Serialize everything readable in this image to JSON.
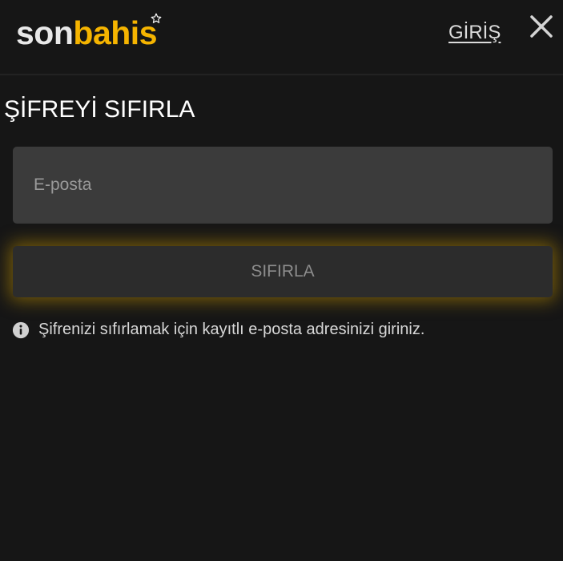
{
  "header": {
    "logo_part1": "son",
    "logo_part2": "bahis",
    "login_label": "GİRİŞ"
  },
  "main": {
    "title": "ŞİFREYİ SIFIRLA",
    "email_placeholder": "E-posta",
    "email_value": "",
    "reset_label": "SIFIRLA",
    "hint": "Şifrenizi sıfırlamak için kayıtlı e-posta adresinizi giriniz."
  },
  "icons": {
    "close": "close-icon",
    "info": "info-icon",
    "star": "star-icon"
  },
  "colors": {
    "background": "#161616",
    "brand_yellow": "#f5b400",
    "input_bg": "#3b3b3b",
    "button_bg": "#2c2c2c",
    "glow": "#c99800"
  }
}
